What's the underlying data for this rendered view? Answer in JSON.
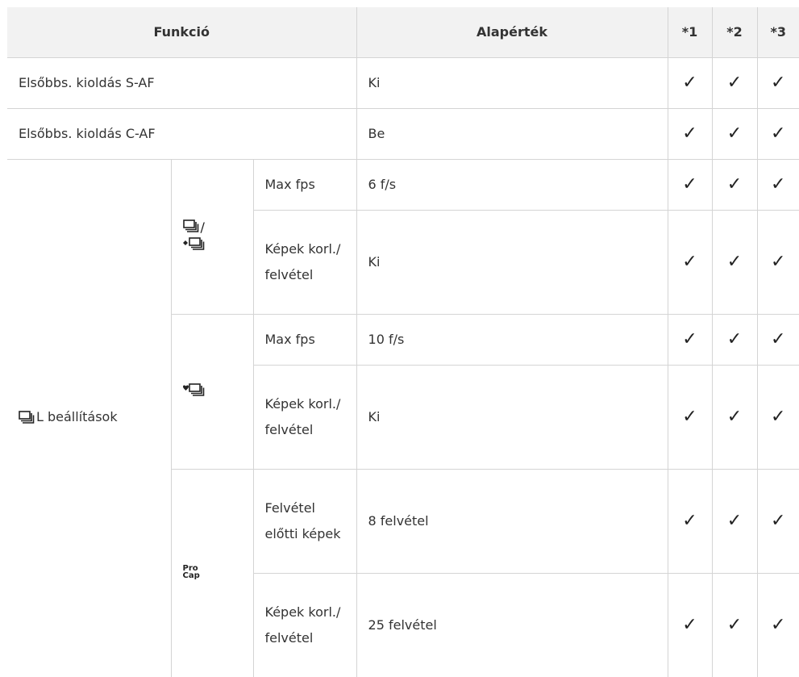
{
  "header": {
    "funkcio": "Funkció",
    "alapertek": "Alapérték",
    "c1": "*1",
    "c2": "*2",
    "c3": "*3"
  },
  "check_glyph": "✓",
  "rows": [
    {
      "label": "Elsőbbs. kioldás S-AF",
      "value": "Ki"
    },
    {
      "label": "Elsőbbs. kioldás C-AF",
      "value": "Be"
    }
  ],
  "group": {
    "label": "L beállítások",
    "label_icon": "sequential-shooting-icon",
    "sub": [
      {
        "icon": "sequential-low-icon",
        "icon_suffix": "/",
        "icon2": "silent-sequential-low-icon",
        "items": [
          {
            "name": "Max fps",
            "value": "6 f/s"
          },
          {
            "name": "Képek korl./ felvétel",
            "value": "Ki"
          }
        ]
      },
      {
        "icon": "silent-sequential-high-icon",
        "items": [
          {
            "name": "Max fps",
            "value": "10 f/s"
          },
          {
            "name": "Képek korl./ felvétel",
            "value": "Ki"
          }
        ]
      },
      {
        "icon": "procap-icon",
        "icon_text_1": "Pro",
        "icon_text_2": "Cap",
        "items": [
          {
            "name": "Felvétel előtti képek",
            "value": "8 felvétel"
          },
          {
            "name": "Képek korl./ felvétel",
            "value": "25 felvétel"
          }
        ]
      }
    ]
  }
}
